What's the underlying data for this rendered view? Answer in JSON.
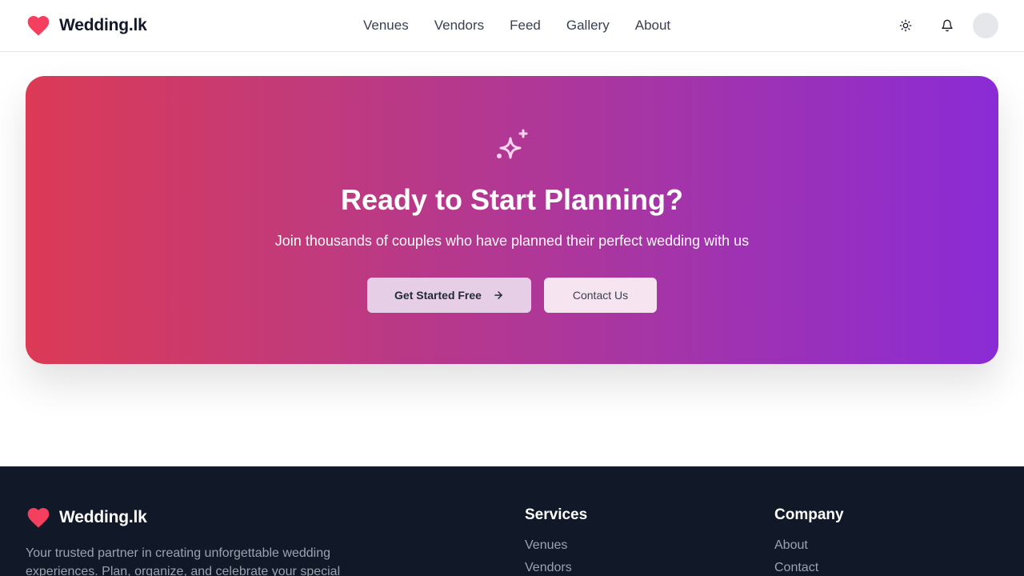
{
  "header": {
    "brand": "Wedding.lk",
    "nav": [
      "Venues",
      "Vendors",
      "Feed",
      "Gallery",
      "About"
    ],
    "icons": {
      "theme": "sun-icon",
      "notifications": "bell-icon"
    }
  },
  "cta": {
    "icon": "sparkles-icon",
    "title": "Ready to Start Planning?",
    "subtitle": "Join thousands of couples who have planned their perfect wedding with us",
    "primary_label": "Get Started Free",
    "secondary_label": "Contact Us"
  },
  "footer": {
    "brand": "Wedding.lk",
    "description": "Your trusted partner in creating unforgettable wedding experiences. Plan, organize, and celebrate your special",
    "services": {
      "heading": "Services",
      "links": [
        "Venues",
        "Vendors"
      ]
    },
    "company": {
      "heading": "Company",
      "links": [
        "About",
        "Contact"
      ]
    }
  },
  "colors": {
    "brand_heart": "#f43f5e",
    "gradient_start": "#dc3a55",
    "gradient_end": "#8a2bd6",
    "footer_bg": "#111827"
  }
}
